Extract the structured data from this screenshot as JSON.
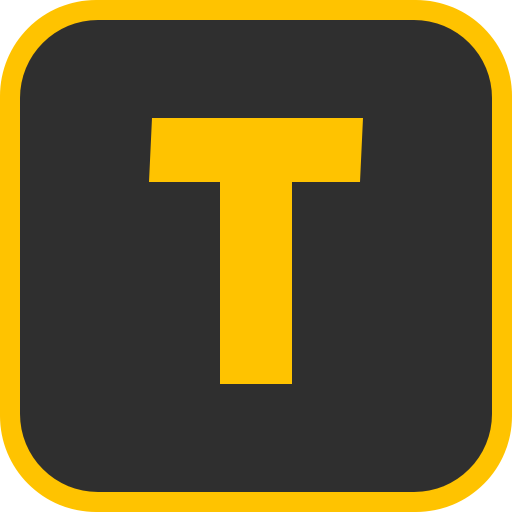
{
  "icon": {
    "name": "T app icon",
    "glyph": "T",
    "colors": {
      "frame": "#FFC300",
      "background": "#2F2F2F",
      "letter": "#FFC300",
      "outside": "#FFFFFF"
    }
  }
}
